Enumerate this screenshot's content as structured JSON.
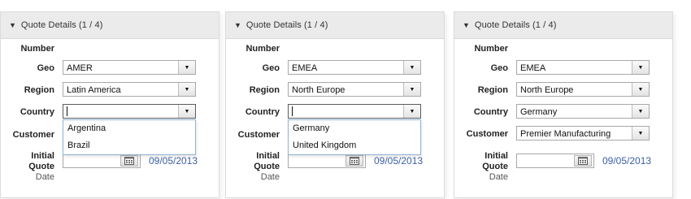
{
  "panels": [
    {
      "header": "Quote Details (1 / 4)",
      "labels": {
        "number": "Number",
        "geo": "Geo",
        "region": "Region",
        "country": "Country",
        "customer": "Customer",
        "initial_quote_date": [
          "Initial",
          "Quote",
          "Date"
        ]
      },
      "geo_value": "AMER",
      "region_value": "Latin America",
      "country_value": "",
      "customer_value": "",
      "dropdown_options": [
        "Argentina",
        "Brazil"
      ],
      "date_value": "09/05/2013"
    },
    {
      "header": "Quote Details (1 / 4)",
      "labels": {
        "number": "Number",
        "geo": "Geo",
        "region": "Region",
        "country": "Country",
        "customer": "Customer",
        "initial_quote_date": [
          "Initial",
          "Quote",
          "Date"
        ]
      },
      "geo_value": "EMEA",
      "region_value": "North Europe",
      "country_value": "",
      "customer_value": "",
      "dropdown_options": [
        "Germany",
        "United Kingdom"
      ],
      "date_value": "09/05/2013"
    },
    {
      "header": "Quote Details (1 / 4)",
      "labels": {
        "number": "Number",
        "geo": "Geo",
        "region": "Region",
        "country": "Country",
        "customer": "Customer",
        "initial_quote_date": [
          "Initial",
          "Quote",
          "Date"
        ]
      },
      "geo_value": "EMEA",
      "region_value": "North Europe",
      "country_value": "Germany",
      "customer_value": "Premier Manufacturing",
      "dropdown_options": [],
      "date_value": "09/05/2013"
    }
  ],
  "icons": {
    "collapse": "triangle-down-icon",
    "dropdown": "triangle-down-icon",
    "calendar": "calendar-icon"
  }
}
